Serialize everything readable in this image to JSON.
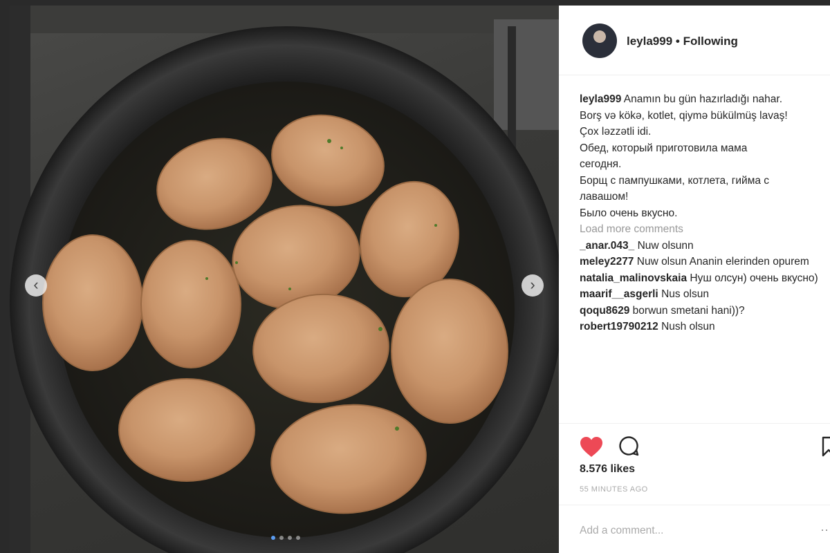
{
  "post": {
    "username": "leyla999",
    "separator": "•",
    "follow_status": "Following",
    "caption_user": "leyla999",
    "caption_lines": [
      "Anamın bu gün hazırladığı nahar.",
      "Borş və kökə, kotlet, qiymə bükülmüş lavaş!",
      "Çox ləzzətli idi.",
      "Обед, который приготовила мама",
      "сегодня.",
      "Борщ с пампушками, котлета, гийма с",
      "лавашом!",
      "Было очень вкусно."
    ],
    "load_more": "Load more comments",
    "comments": [
      {
        "user": "_anar.043_",
        "text": "Nuw olsunn"
      },
      {
        "user": "meley2277",
        "text": "Nuw olsun Ananin elerinden opurem"
      },
      {
        "user": "natalia_malinovskaia",
        "text": "Нуш олсун) очень вкусно)"
      },
      {
        "user": "maarif__asgerli",
        "text": "Nus olsun"
      },
      {
        "user": "qoqu8629",
        "text": "borwun smetani hani))?"
      },
      {
        "user": "robert19790212",
        "text": "Nush olsun"
      }
    ],
    "likes": "8.576 likes",
    "timestamp": "55 MINUTES AGO",
    "add_comment_placeholder": "Add a comment..."
  },
  "icons": {
    "like": "heart-icon",
    "comment": "comment-bubble-icon",
    "save": "bookmark-icon",
    "prev": "chevron-left-icon",
    "next": "chevron-right-icon"
  },
  "carousel": {
    "count": 4,
    "active_index": 0
  },
  "colors": {
    "like_red": "#ed4956",
    "text": "#262626",
    "muted": "#999999"
  }
}
